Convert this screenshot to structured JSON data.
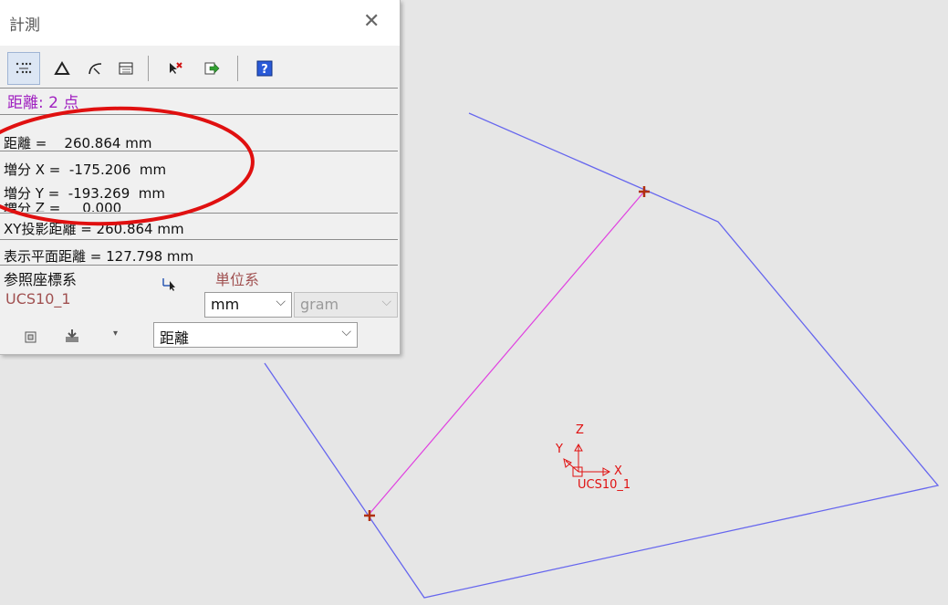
{
  "window": {
    "title": "計測",
    "close_glyph": "✕"
  },
  "toolbar": {
    "icons": [
      "points-distance-icon",
      "triangle-icon",
      "arc-icon",
      "table-icon",
      "clear-selection-icon",
      "export-icon",
      "help-icon"
    ]
  },
  "mode_label": "距離: 2 点",
  "results": {
    "distance": "距離 =    260.864 mm",
    "delta_x": "増分 X =  -175.206  mm",
    "delta_y": "増分 Y =  -193.269  mm",
    "delta_z_partial": "増分 Z =     0.000",
    "xy_projected": "XY投影距離 = 260.864 mm",
    "display_plane": "表示平面距離 = 127.798 mm"
  },
  "reference": {
    "label": "参照座標系",
    "value": "UCS10_1"
  },
  "units": {
    "label": "単位系",
    "length": "mm",
    "mass": "gram"
  },
  "measure_type": "距離",
  "viewport": {
    "ucs_label": "UCS10_1",
    "axis_x": "X",
    "axis_y": "Y",
    "axis_z": "Z",
    "colors": {
      "polyline": "#6666ee",
      "measure_line": "#e040e0",
      "pick_marker": "#b03010",
      "axes": "#e01010",
      "annotation_ellipse": "#e01010"
    }
  }
}
